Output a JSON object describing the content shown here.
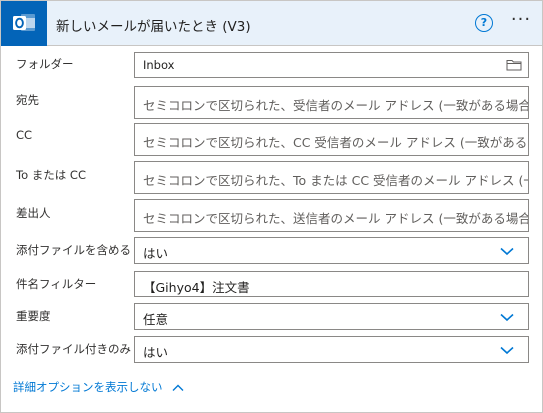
{
  "header": {
    "title": "新しいメールが届いたとき (V3)",
    "help_label": "?",
    "more_label": "···",
    "accent": "#0364b8",
    "icon": "outlook-icon"
  },
  "fields": {
    "folder": {
      "label": "フォルダー",
      "value": "Inbox"
    },
    "to": {
      "label": "宛先",
      "placeholder": "セミコロンで区切られた、受信者のメール アドレス (一致がある場合"
    },
    "cc": {
      "label": "CC",
      "placeholder": "セミコロンで区切られた、CC 受信者のメール アドレス (一致がある"
    },
    "to_or_cc": {
      "label": "To または CC",
      "placeholder": "セミコロンで区切られた、To または CC 受信者のメール アドレス (一"
    },
    "from": {
      "label": "差出人",
      "placeholder": "セミコロンで区切られた、送信者のメール アドレス (一致がある場合"
    },
    "include_attachments": {
      "label": "添付ファイルを含める",
      "value": "はい"
    },
    "subject_filter": {
      "label": "件名フィルター",
      "value": "【Gihyo4】注文書"
    },
    "importance": {
      "label": "重要度",
      "value": "任意"
    },
    "only_with_attachments": {
      "label": "添付ファイル付きのみ",
      "value": "はい"
    }
  },
  "advanced": {
    "label": "詳細オプションを表示しない"
  }
}
